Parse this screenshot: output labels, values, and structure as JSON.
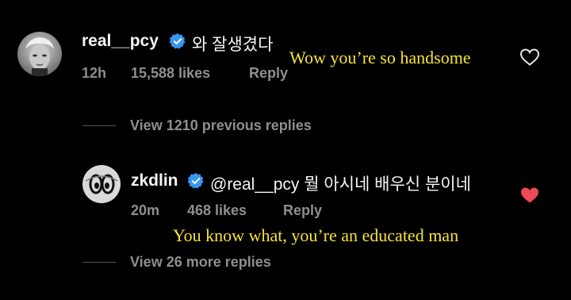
{
  "comment": {
    "username": "real__pcy",
    "text": "와 잘생겼다",
    "time": "12h",
    "likes": "15,588 likes",
    "reply_label": "Reply",
    "translation": "Wow you’re so handsome",
    "like_icon": "heart-outline-icon"
  },
  "view_previous": "View 1210 previous replies",
  "reply": {
    "username": "zkdlin",
    "text": "@real__pcy 뭘 아시네 배우신 분이네",
    "time": "20m",
    "likes": "468 likes",
    "reply_label": "Reply",
    "translation": "You know what, you’re an educated man",
    "like_icon": "heart-filled-icon",
    "like_color": "#ed4956"
  },
  "view_more": "View 26 more replies",
  "verified_color": "#3797f0"
}
